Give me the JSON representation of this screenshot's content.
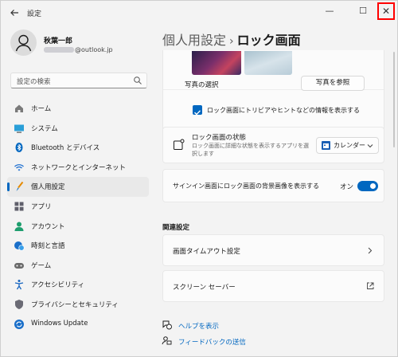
{
  "window": {
    "title": "設定",
    "back_icon": "arrow-left-icon",
    "controls": {
      "minimize": "—",
      "maximize": "☐",
      "close": "✕"
    }
  },
  "user": {
    "name": "秋葉一郎",
    "email_suffix": "@outlook.jp"
  },
  "search": {
    "placeholder": "設定の検索"
  },
  "sidebar": {
    "items": [
      {
        "label": "ホーム",
        "icon": "home-icon"
      },
      {
        "label": "システム",
        "icon": "monitor-icon"
      },
      {
        "label": "Bluetooth とデバイス",
        "icon": "bluetooth-icon"
      },
      {
        "label": "ネットワークとインターネット",
        "icon": "wifi-icon"
      },
      {
        "label": "個人用設定",
        "icon": "brush-icon",
        "active": true
      },
      {
        "label": "アプリ",
        "icon": "apps-icon"
      },
      {
        "label": "アカウント",
        "icon": "account-icon"
      },
      {
        "label": "時刻と言語",
        "icon": "globe-clock-icon"
      },
      {
        "label": "ゲーム",
        "icon": "gamepad-icon"
      },
      {
        "label": "アクセシビリティ",
        "icon": "accessibility-icon"
      },
      {
        "label": "プライバシーとセキュリティ",
        "icon": "shield-icon"
      },
      {
        "label": "Windows Update",
        "icon": "update-icon"
      }
    ]
  },
  "breadcrumb": {
    "parent": "個人用設定",
    "separator": "›",
    "current": "ロック画面"
  },
  "photo": {
    "choose_label": "写真の選択",
    "browse_button": "写真を参照",
    "trivia_checkbox_label": "ロック画面にトリビアやヒントなどの情報を表示する",
    "trivia_checked": true
  },
  "lock_status": {
    "title": "ロック画面の状態",
    "description_line1": "ロック画面に詳細な状態を表示するアプリを選",
    "description_line2": "択します",
    "selected_app": "カレンダー"
  },
  "signin_background": {
    "label": "サインイン画面にロック画面の背景画像を表示する",
    "state_label": "オン",
    "enabled": true
  },
  "related": {
    "heading": "関連設定",
    "items": [
      {
        "label": "画面タイムアウト設定",
        "icon": "chevron-right-icon"
      },
      {
        "label": "スクリーン セーバー",
        "icon": "open-external-icon"
      }
    ]
  },
  "links": {
    "help": "ヘルプを表示",
    "feedback": "フィードバックの送信"
  },
  "colors": {
    "accent": "#0067c0",
    "close_highlight": "#ff0000",
    "background": "#f3f3f3",
    "card": "#fbfbfb"
  }
}
